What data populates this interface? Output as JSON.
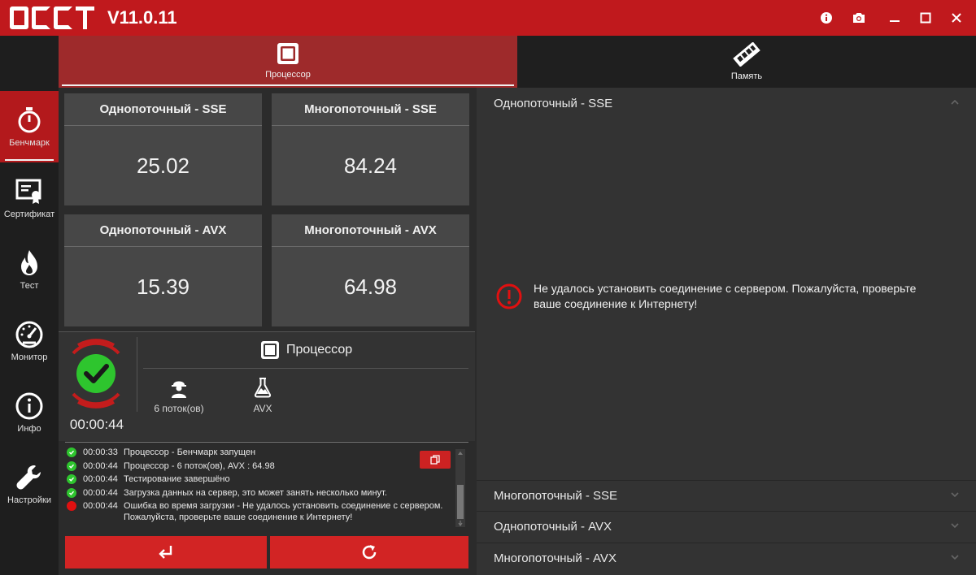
{
  "app": {
    "version": "V11.0.11"
  },
  "nav": [
    {
      "label": "Бенчмарк",
      "icon": "stopwatch-icon",
      "active": true
    },
    {
      "label": "Сертификат",
      "icon": "certificate-icon"
    },
    {
      "label": "Тест",
      "icon": "flame-icon"
    },
    {
      "label": "Монитор",
      "icon": "speedometer-icon"
    },
    {
      "label": "Инфо",
      "icon": "info-icon"
    },
    {
      "label": "Настройки",
      "icon": "wrench-icon"
    }
  ],
  "tabs": [
    {
      "label": "Процессор",
      "icon": "cpu-icon",
      "active": true
    },
    {
      "label": "Память",
      "icon": "memory-icon"
    }
  ],
  "cards": [
    {
      "title": "Однопоточный - SSE",
      "value": "25.02"
    },
    {
      "title": "Многопоточный - SSE",
      "value": "84.24"
    },
    {
      "title": "Однопоточный - AVX",
      "value": "15.39"
    },
    {
      "title": "Многопоточный - AVX",
      "value": "64.98"
    }
  ],
  "status": {
    "timer": "00:00:44",
    "processor_label": "Процессор",
    "threads": "6 поток(ов)",
    "instruction": "AVX"
  },
  "log": [
    {
      "status": "ok",
      "time": "00:00:33",
      "message": "Процессор - Бенчмарк запущен"
    },
    {
      "status": "ok",
      "time": "00:00:44",
      "message": "Процессор - 6 поток(ов), AVX : 64.98"
    },
    {
      "status": "ok",
      "time": "00:00:44",
      "message": "Тестирование завершёно"
    },
    {
      "status": "ok",
      "time": "00:00:44",
      "message": "Загрузка данных на сервер, это может занять несколько минут."
    },
    {
      "status": "error",
      "time": "00:00:44",
      "message": "Ошибка во время загрузки - Не удалось установить соединение с сервером. Пожалуйста, проверьте ваше соединение к Интернету!"
    }
  ],
  "accordion": [
    {
      "title": "Однопоточный - SSE",
      "expanded": true
    },
    {
      "title": "Многопоточный - SSE"
    },
    {
      "title": "Однопоточный - AVX"
    },
    {
      "title": "Многопоточный - AVX"
    }
  ],
  "error_message": "Не удалось установить соединение с сервером. Пожалуйста, проверьте ваше соединение к Интернету!",
  "colors": {
    "accent": "#c0191d",
    "success": "#2ec52e",
    "error": "#e01010"
  }
}
